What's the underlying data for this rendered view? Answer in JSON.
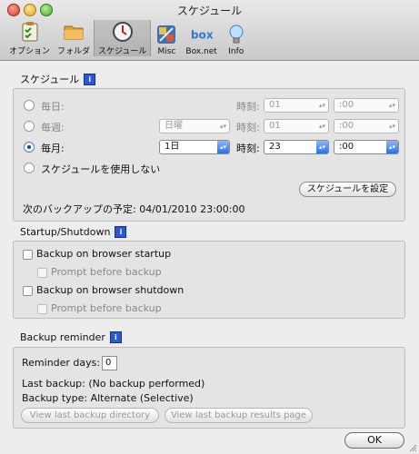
{
  "window": {
    "title": "スケジュール"
  },
  "toolbar": {
    "items": [
      {
        "label": "オプション",
        "icon": "options-checklist-icon"
      },
      {
        "label": "フォルダ",
        "icon": "folder-icon"
      },
      {
        "label": "スケジュール",
        "icon": "schedule-clock-icon",
        "selected": true
      },
      {
        "label": "Misc",
        "icon": "misc-tools-icon"
      },
      {
        "label": "Box.net",
        "icon": "box-logo-icon"
      },
      {
        "label": "Info",
        "icon": "info-bulb-icon"
      }
    ]
  },
  "schedule": {
    "title": "スケジュール",
    "info": "i",
    "options": [
      {
        "label": "毎日:",
        "selected": false
      },
      {
        "label": "毎週:",
        "selected": false
      },
      {
        "label": "毎月:",
        "selected": true
      },
      {
        "label": "スケジュールを使用しない",
        "selected": false
      }
    ],
    "time_label": "時刻:",
    "daily": {
      "hour": "01",
      "minute": ":00"
    },
    "weekly": {
      "day": "日曜",
      "hour": "01",
      "minute": ":00"
    },
    "monthly": {
      "day": "1日",
      "hour": "23",
      "minute": ":00"
    },
    "set_button": "スケジュールを設定",
    "next_backup": "次のバックアップの予定: 04/01/2010 23:00:00"
  },
  "startup": {
    "title": "Startup/Shutdown",
    "info": "i",
    "backup_startup": "Backup on browser startup",
    "prompt_startup": "Prompt before backup",
    "backup_shutdown": "Backup on browser shutdown",
    "prompt_shutdown": "Prompt before backup"
  },
  "reminder": {
    "title": "Backup reminder",
    "info": "i",
    "days_label": "Reminder days:",
    "days_value": "0",
    "last_backup": "Last backup:  (No backup performed)",
    "backup_type": "Backup type:  Alternate (Selective)",
    "view_dir_button": "View last backup directory",
    "view_results_button": "View last backup results page"
  },
  "footer": {
    "ok_button": "OK"
  },
  "colors": {
    "accent": "#2c6fe2",
    "info_badge": "#2c58d7"
  }
}
